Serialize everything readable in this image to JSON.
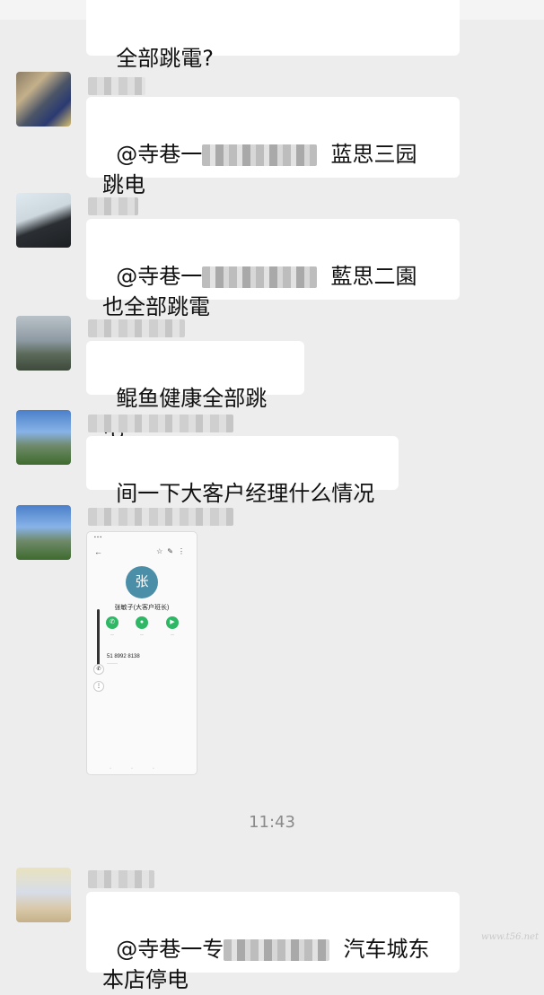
{
  "messages": [
    {
      "text": "全部跳電?"
    },
    {
      "prefix": "@寺巷一",
      "text": "  蓝思三园\n跳电"
    },
    {
      "prefix": "@寺巷一",
      "text": "  藍思二園\n也全部跳電"
    },
    {
      "text": "鲲鱼健康全部跳电"
    },
    {
      "text": "间一下大客户经理什么情况"
    },
    {
      "contact_card": {
        "avatar_char": "张",
        "name": "张敏子(大客户班长)",
        "number": "51 8992 8138"
      }
    },
    {
      "prefix": "@寺巷一专",
      "text": "  汽车城东\n本店停电"
    }
  ],
  "timestamp": "11:43",
  "watermark": "www.t56.net"
}
